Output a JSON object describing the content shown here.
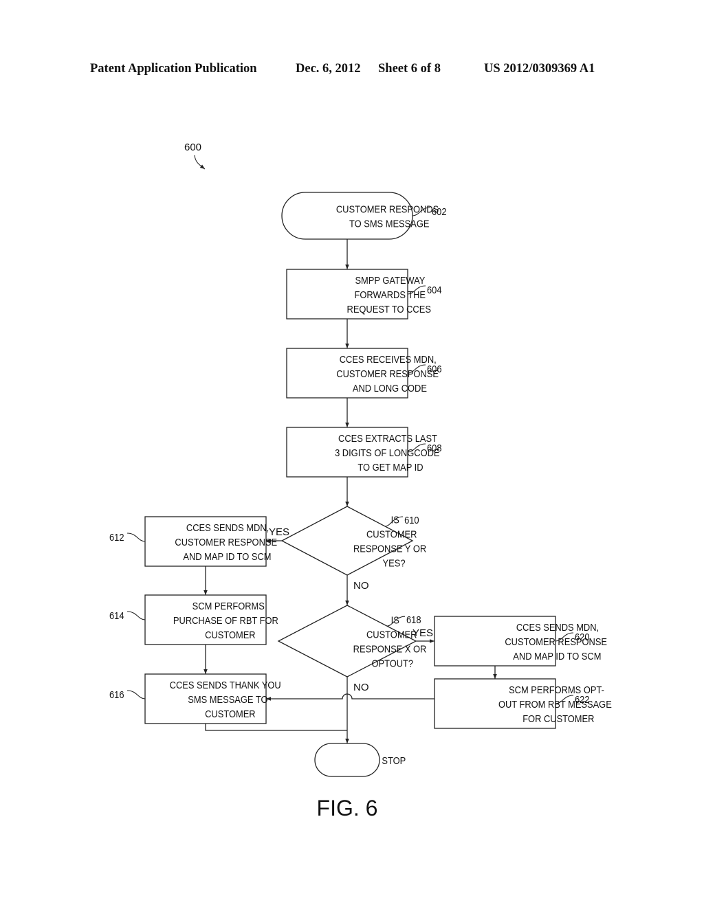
{
  "header": {
    "publication": "Patent Application Publication",
    "date": "Dec. 6, 2012",
    "sheet": "Sheet 6 of 8",
    "patent_number": "US 2012/0309369 A1"
  },
  "figure": {
    "ref": "600",
    "label": "FIG. 6"
  },
  "nodes": {
    "n602": {
      "ref": "602",
      "type": "terminal",
      "lines": [
        "CUSTOMER RESPONDS",
        "TO SMS MESSAGE"
      ]
    },
    "n604": {
      "ref": "604",
      "type": "process",
      "lines": [
        "SMPP GATEWAY",
        "FORWARDS THE",
        "REQUEST TO CCES"
      ]
    },
    "n606": {
      "ref": "606",
      "type": "process",
      "lines": [
        "CCES RECEIVES MDN,",
        "CUSTOMER RESPONSE",
        "AND LONG CODE"
      ]
    },
    "n608": {
      "ref": "608",
      "type": "process",
      "lines": [
        "CCES EXTRACTS LAST",
        "3 DIGITS OF LONGCODE",
        "TO GET MAP ID"
      ]
    },
    "n610": {
      "ref": "610",
      "type": "decision",
      "lines": [
        "IS",
        "CUSTOMER",
        "RESPONSE Y OR",
        "YES?"
      ]
    },
    "n612": {
      "ref": "612",
      "type": "process",
      "lines": [
        "CCES SENDS MDN,",
        "CUSTOMER RESPONSE",
        "AND MAP ID TO SCM"
      ]
    },
    "n614": {
      "ref": "614",
      "type": "process",
      "lines": [
        "SCM PERFORMS",
        "PURCHASE OF RBT FOR",
        "CUSTOMER"
      ]
    },
    "n616": {
      "ref": "616",
      "type": "process",
      "lines": [
        "CCES SENDS THANK YOU",
        "SMS MESSAGE TO",
        "CUSTOMER"
      ]
    },
    "n618": {
      "ref": "618",
      "type": "decision",
      "lines": [
        "IS",
        "CUSTOMER",
        "RESPONSE X OR",
        "OPTOUT?"
      ]
    },
    "n620": {
      "ref": "620",
      "type": "process",
      "lines": [
        "CCES SENDS MDN,",
        "CUSTOMER RESPONSE",
        "AND MAP ID TO SCM"
      ]
    },
    "n622": {
      "ref": "622",
      "type": "process",
      "lines": [
        "SCM PERFORMS OPT-",
        "OUT FROM RBT MESSAGE",
        "FOR CUSTOMER"
      ]
    },
    "stop": {
      "ref": "",
      "type": "terminal",
      "lines": [
        "STOP"
      ]
    }
  },
  "edges": [
    {
      "from": "n602",
      "to": "n604",
      "label": ""
    },
    {
      "from": "n604",
      "to": "n606",
      "label": ""
    },
    {
      "from": "n606",
      "to": "n608",
      "label": ""
    },
    {
      "from": "n608",
      "to": "n610",
      "label": ""
    },
    {
      "from": "n610",
      "to": "n612",
      "label": "YES"
    },
    {
      "from": "n610",
      "to": "n618",
      "label": "NO"
    },
    {
      "from": "n612",
      "to": "n614",
      "label": ""
    },
    {
      "from": "n614",
      "to": "n616",
      "label": ""
    },
    {
      "from": "n618",
      "to": "n620",
      "label": "YES"
    },
    {
      "from": "n618",
      "to": "stop",
      "label": "NO"
    },
    {
      "from": "n620",
      "to": "n622",
      "label": ""
    },
    {
      "from": "n622",
      "to": "n616",
      "label": ""
    },
    {
      "from": "n616",
      "to": "stop",
      "label": ""
    }
  ]
}
